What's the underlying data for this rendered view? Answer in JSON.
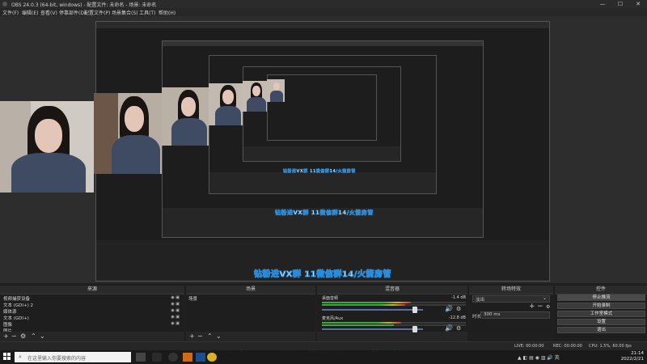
{
  "window": {
    "title": "OBS 24.0.3 (64-bit, windows) - 配置文件: 未命名 - 场景: 未命名",
    "minimize": "—",
    "maximize": "☐",
    "close": "✕"
  },
  "menu": [
    "文件(F)",
    "编辑(E)",
    "查看(V)",
    "停靠部件(D)",
    "配置文件(P)",
    "场景集合(S)",
    "工具(T)",
    "帮助(H)"
  ],
  "docks": {
    "sources_title": "来源",
    "scenes_title": "场景",
    "mixer_title": "混音器",
    "transitions_title": "转场特效",
    "controls_title": "控件"
  },
  "sources": [
    "视频捕获设备",
    "文本 (GDI+) 2",
    "媒体源",
    "文本 (GDI+)",
    "图像",
    "图片"
  ],
  "scenes": [
    "场景"
  ],
  "mixer": {
    "tracks": [
      {
        "name": "桌面音频",
        "db": "-1.4 dB",
        "level": 0.62
      },
      {
        "name": "麦克风/Aux",
        "db": "-12.8 dB",
        "level": 0.55
      }
    ]
  },
  "transitions": {
    "type": "淡出",
    "duration_label": "时长",
    "duration_value": "300 ms"
  },
  "controls": [
    "停止推流",
    "开始录制",
    "工作室模式",
    "设置",
    "退出"
  ],
  "status": {
    "live": "LIVE: 00:00:00",
    "rec": "REC: 00:00:00",
    "cpu": "CPU: 1.5%, 60.00 fps"
  },
  "taskbar": {
    "search_placeholder": "在这里输入你要搜索的内容",
    "time": "21:14",
    "date": "2022/2/21"
  },
  "overlay_text": "钻粉进VX群 11微信群14/火箭房管",
  "colors": {
    "accent_blue": "#2a8bd8",
    "meter_green": "#3ea63e",
    "meter_yellow": "#c8b43a",
    "meter_red": "#c03a3a"
  }
}
